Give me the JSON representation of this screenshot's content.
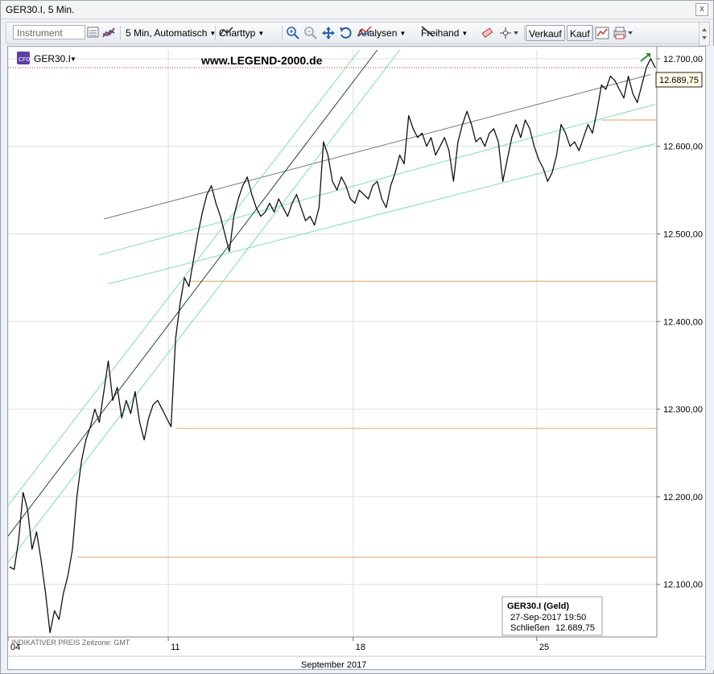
{
  "window": {
    "title": "GER30.I, 5 Min.",
    "close_label": "x"
  },
  "toolbar": {
    "instrument_placeholder": "Instrument",
    "interval": "5 Min,  Automatisch",
    "charttype": "Charttyp",
    "analysen": "Analysen",
    "freihand": "Freihand",
    "verkauf": "Verkauf",
    "kauf": "Kauf"
  },
  "chart_header": {
    "symbol": "GER30.I",
    "watermark": "www.LEGEND-2000.de",
    "price_flag": "12.689,75",
    "footer_note": "INDIKATIVER PREIS   Zeitzone: GMT",
    "month_label": "September 2017"
  },
  "info_box": {
    "title": "GER30.I (Geld)",
    "datetime": "27-Sep-2017 19:50",
    "close_label": "Schließen",
    "close_value": "12.689,75"
  },
  "chart_data": {
    "type": "line",
    "title": "",
    "xlabel": "September 2017",
    "ylabel": "",
    "ylim": [
      12040,
      12710
    ],
    "ytick_values": [
      12100,
      12200,
      12300,
      12400,
      12500,
      12600,
      12700
    ],
    "ytick_labels": [
      "12.100,00",
      "12.200,00",
      "12.300,00",
      "12.400,00",
      "12.500,00",
      "12.600,00",
      "12.700,00"
    ],
    "xtick_labels": [
      "04",
      "11",
      "18",
      "25"
    ],
    "grid": true,
    "legend": "none",
    "last_price": 12689.75,
    "series": [
      {
        "name": "GER30.I",
        "x": [
          0,
          1,
          2,
          3,
          4,
          5,
          6,
          7,
          8,
          9,
          10,
          11,
          12,
          13,
          14,
          15,
          16,
          17,
          18,
          19,
          20,
          21,
          22,
          23,
          24,
          25,
          26,
          27,
          28,
          29,
          30,
          31,
          32,
          33,
          34,
          35,
          36,
          37,
          38,
          39,
          40,
          41,
          42,
          43,
          44,
          45,
          46,
          47,
          48,
          49,
          50,
          51,
          52,
          53,
          54,
          55,
          56,
          57,
          58,
          59,
          60,
          61,
          62,
          63,
          64,
          65,
          66,
          67,
          68,
          69,
          70,
          71,
          72,
          73,
          74,
          75,
          76,
          77,
          78,
          79,
          80,
          81,
          82,
          83,
          84,
          85,
          86,
          87,
          88,
          89,
          90,
          91,
          92,
          93,
          94,
          95,
          96,
          97,
          98,
          99,
          100,
          101,
          102,
          103,
          104,
          105,
          106,
          107,
          108,
          109,
          110,
          111,
          112,
          113,
          114,
          115,
          116,
          117,
          118,
          119,
          120,
          121,
          122,
          123,
          124,
          125,
          126,
          127,
          128,
          129,
          130,
          131,
          132,
          133,
          134,
          135,
          136,
          137,
          138,
          139,
          140,
          141,
          142,
          143,
          144
        ],
        "y": [
          12120,
          12117,
          12150,
          12205,
          12185,
          12140,
          12160,
          12128,
          12090,
          12045,
          12070,
          12060,
          12090,
          12110,
          12140,
          12200,
          12240,
          12265,
          12280,
          12300,
          12285,
          12320,
          12355,
          12310,
          12325,
          12290,
          12310,
          12295,
          12320,
          12285,
          12265,
          12290,
          12305,
          12310,
          12300,
          12290,
          12280,
          12380,
          12420,
          12450,
          12440,
          12470,
          12500,
          12525,
          12545,
          12555,
          12535,
          12520,
          12500,
          12480,
          12520,
          12540,
          12555,
          12565,
          12545,
          12530,
          12520,
          12525,
          12535,
          12525,
          12540,
          12530,
          12520,
          12535,
          12545,
          12530,
          12515,
          12520,
          12510,
          12530,
          12605,
          12590,
          12560,
          12550,
          12565,
          12555,
          12540,
          12535,
          12550,
          12545,
          12540,
          12555,
          12560,
          12540,
          12530,
          12555,
          12570,
          12590,
          12580,
          12635,
          12620,
          12610,
          12615,
          12600,
          12610,
          12590,
          12600,
          12610,
          12595,
          12560,
          12605,
          12625,
          12640,
          12625,
          12605,
          12610,
          12600,
          12615,
          12620,
          12605,
          12560,
          12585,
          12610,
          12625,
          12610,
          12630,
          12620,
          12600,
          12585,
          12575,
          12560,
          12570,
          12590,
          12625,
          12615,
          12600,
          12605,
          12595,
          12610,
          12625,
          12615,
          12640,
          12670,
          12665,
          12680,
          12675,
          12665,
          12655,
          12680,
          12660,
          12650,
          12670,
          12690,
          12700,
          12689.75
        ]
      }
    ]
  }
}
